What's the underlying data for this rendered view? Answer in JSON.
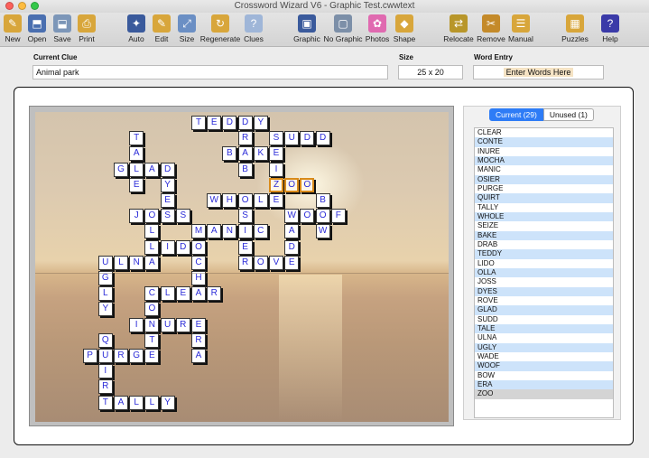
{
  "window": {
    "title": "Crossword Wizard V6 - Graphic Test.cwwtext"
  },
  "toolbar": {
    "items": [
      {
        "label": "New",
        "icon": "new-icon",
        "color": "#d8a63b"
      },
      {
        "label": "Open",
        "icon": "open-icon",
        "color": "#4a6fb0"
      },
      {
        "label": "Save",
        "icon": "save-icon",
        "color": "#7c96b8"
      },
      {
        "label": "Print",
        "icon": "print-icon",
        "color": "#d8a63b"
      },
      {
        "label": "Auto",
        "icon": "auto-icon",
        "color": "#3a5a9c"
      },
      {
        "label": "Edit",
        "icon": "edit-icon",
        "color": "#d8a63b"
      },
      {
        "label": "Size",
        "icon": "size-icon",
        "color": "#6b8fc4"
      },
      {
        "label": "Regenerate",
        "icon": "regenerate-icon",
        "color": "#d8a63b"
      },
      {
        "label": "Clues",
        "icon": "clues-icon",
        "color": "#9fb6d8"
      },
      {
        "label": "Graphic",
        "icon": "graphic-icon",
        "color": "#3a5a9c"
      },
      {
        "label": "No Graphic",
        "icon": "no-graphic-icon",
        "color": "#7c8fa8"
      },
      {
        "label": "Photos",
        "icon": "photos-icon",
        "color": "#e06ab0"
      },
      {
        "label": "Shape",
        "icon": "shape-icon",
        "color": "#d8a63b"
      },
      {
        "label": "Relocate",
        "icon": "relocate-icon",
        "color": "#b8962a"
      },
      {
        "label": "Remove",
        "icon": "remove-icon",
        "color": "#c48a2a"
      },
      {
        "label": "Manual",
        "icon": "manual-icon",
        "color": "#d8a63b"
      },
      {
        "label": "Puzzles",
        "icon": "puzzles-icon",
        "color": "#d8a63b"
      },
      {
        "label": "Help",
        "icon": "help-icon",
        "color": "#3a3aa8"
      }
    ]
  },
  "fields": {
    "current_clue_label": "Current Clue",
    "current_clue_value": "Animal park",
    "size_label": "Size",
    "size_value": "25 x 20",
    "word_entry_label": "Word Entry",
    "word_entry_placeholder": "Enter Words Here"
  },
  "tabs": {
    "current": "Current (29)",
    "unused": "Unused (1)"
  },
  "words": [
    "CLEAR",
    "CONTE",
    "INURE",
    "MOCHA",
    "MANIC",
    "OSIER",
    "PURGE",
    "QUIRT",
    "TALLY",
    "WHOLE",
    "SEIZE",
    "BAKE",
    "DRAB",
    "TEDDY",
    "LIDO",
    "OLLA",
    "JOSS",
    "DYES",
    "ROVE",
    "GLAD",
    "SUDD",
    "TALE",
    "ULNA",
    "UGLY",
    "WADE",
    "WOOF",
    "BOW",
    "ERA",
    "ZOO"
  ],
  "selected_word": "ZOO",
  "grid_cells": [
    {
      "c": "T",
      "x": 0.0,
      "y": 0,
      "hl": false
    },
    {
      "c": "E",
      "x": 1.0,
      "y": 0,
      "hl": false
    },
    {
      "c": "D",
      "x": 2.0,
      "y": 0,
      "hl": false
    },
    {
      "c": "D",
      "x": 3.0,
      "y": 0,
      "hl": false
    },
    {
      "c": "Y",
      "x": 4.0,
      "y": 0,
      "hl": false
    },
    {
      "c": "R",
      "x": 3.0,
      "y": 1,
      "hl": false
    },
    {
      "c": "S",
      "x": 5.0,
      "y": 1,
      "hl": false
    },
    {
      "c": "U",
      "x": 6.0,
      "y": 1,
      "hl": false
    },
    {
      "c": "D",
      "x": 7.0,
      "y": 1,
      "hl": false
    },
    {
      "c": "D",
      "x": 8.0,
      "y": 1,
      "hl": false
    },
    {
      "c": "T",
      "x": -4.0,
      "y": 1,
      "hl": false
    },
    {
      "c": "A",
      "x": -4.0,
      "y": 2,
      "hl": false
    },
    {
      "c": "L",
      "x": -4.0,
      "y": 3,
      "hl": false
    },
    {
      "c": "E",
      "x": -4.0,
      "y": 4,
      "hl": false
    },
    {
      "c": "B",
      "x": 2.0,
      "y": 2,
      "hl": false
    },
    {
      "c": "A",
      "x": 3.0,
      "y": 2,
      "hl": false
    },
    {
      "c": "K",
      "x": 4.0,
      "y": 2,
      "hl": false
    },
    {
      "c": "E",
      "x": 5.0,
      "y": 2,
      "hl": false
    },
    {
      "c": "G",
      "x": -5.0,
      "y": 3,
      "hl": false
    },
    {
      "c": "A",
      "x": -3.0,
      "y": 3,
      "hl": false
    },
    {
      "c": "D",
      "x": -2.0,
      "y": 3,
      "hl": false
    },
    {
      "c": "B",
      "x": 3.0,
      "y": 3,
      "hl": false
    },
    {
      "c": "I",
      "x": 5.0,
      "y": 3,
      "hl": false
    },
    {
      "c": "Z",
      "x": 5.0,
      "y": 4,
      "hl": true
    },
    {
      "c": "O",
      "x": 6.0,
      "y": 4,
      "hl": true
    },
    {
      "c": "O",
      "x": 7.0,
      "y": 4,
      "hl": true
    },
    {
      "c": "Y",
      "x": -2.0,
      "y": 4,
      "hl": false
    },
    {
      "c": "E",
      "x": -2.0,
      "y": 5,
      "hl": false
    },
    {
      "c": "W",
      "x": 1.0,
      "y": 5,
      "hl": false
    },
    {
      "c": "H",
      "x": 2.0,
      "y": 5,
      "hl": false
    },
    {
      "c": "O",
      "x": 3.0,
      "y": 5,
      "hl": false
    },
    {
      "c": "L",
      "x": 4.0,
      "y": 5,
      "hl": false
    },
    {
      "c": "E",
      "x": 5.0,
      "y": 5,
      "hl": false
    },
    {
      "c": "B",
      "x": 8.0,
      "y": 5,
      "hl": false
    },
    {
      "c": "J",
      "x": -4.0,
      "y": 6,
      "hl": false
    },
    {
      "c": "O",
      "x": -3.0,
      "y": 6,
      "hl": false
    },
    {
      "c": "S",
      "x": -2.0,
      "y": 6,
      "hl": false
    },
    {
      "c": "S",
      "x": -1.0,
      "y": 6,
      "hl": false
    },
    {
      "c": "S",
      "x": 3.0,
      "y": 6,
      "hl": false
    },
    {
      "c": "W",
      "x": 6.0,
      "y": 6,
      "hl": false
    },
    {
      "c": "O",
      "x": 7.0,
      "y": 6,
      "hl": false
    },
    {
      "c": "O",
      "x": 8.0,
      "y": 6,
      "hl": false
    },
    {
      "c": "F",
      "x": 9.0,
      "y": 6,
      "hl": false
    },
    {
      "c": "L",
      "x": -3.0,
      "y": 7,
      "hl": false
    },
    {
      "c": "M",
      "x": 0.0,
      "y": 7,
      "hl": false
    },
    {
      "c": "A",
      "x": 1.0,
      "y": 7,
      "hl": false
    },
    {
      "c": "N",
      "x": 2.0,
      "y": 7,
      "hl": false
    },
    {
      "c": "I",
      "x": 3.0,
      "y": 7,
      "hl": false
    },
    {
      "c": "C",
      "x": 4.0,
      "y": 7,
      "hl": false
    },
    {
      "c": "A",
      "x": 6.0,
      "y": 7,
      "hl": false
    },
    {
      "c": "W",
      "x": 8.0,
      "y": 7,
      "hl": false
    },
    {
      "c": "L",
      "x": -3.0,
      "y": 8,
      "hl": false
    },
    {
      "c": "I",
      "x": -2.0,
      "y": 8,
      "hl": false
    },
    {
      "c": "D",
      "x": -1.0,
      "y": 8,
      "hl": false
    },
    {
      "c": "O",
      "x": 0.0,
      "y": 8,
      "hl": false
    },
    {
      "c": "E",
      "x": 3.0,
      "y": 8,
      "hl": false
    },
    {
      "c": "D",
      "x": 6.0,
      "y": 8,
      "hl": false
    },
    {
      "c": "U",
      "x": -6.0,
      "y": 9,
      "hl": false
    },
    {
      "c": "L",
      "x": -5.0,
      "y": 9,
      "hl": false
    },
    {
      "c": "N",
      "x": -4.0,
      "y": 9,
      "hl": false
    },
    {
      "c": "A",
      "x": -3.0,
      "y": 9,
      "hl": false
    },
    {
      "c": "C",
      "x": 0.0,
      "y": 9,
      "hl": false
    },
    {
      "c": "R",
      "x": 3.0,
      "y": 9,
      "hl": false
    },
    {
      "c": "O",
      "x": 4.0,
      "y": 9,
      "hl": false
    },
    {
      "c": "V",
      "x": 5.0,
      "y": 9,
      "hl": false
    },
    {
      "c": "E",
      "x": 6.0,
      "y": 9,
      "hl": false
    },
    {
      "c": "G",
      "x": -6.0,
      "y": 10,
      "hl": false
    },
    {
      "c": "H",
      "x": 0.0,
      "y": 10,
      "hl": false
    },
    {
      "c": "L",
      "x": -6.0,
      "y": 11,
      "hl": false
    },
    {
      "c": "C",
      "x": -3.0,
      "y": 11,
      "hl": false
    },
    {
      "c": "L",
      "x": -2.0,
      "y": 11,
      "hl": false
    },
    {
      "c": "E",
      "x": -1.0,
      "y": 11,
      "hl": false
    },
    {
      "c": "A",
      "x": 0.0,
      "y": 11,
      "hl": false
    },
    {
      "c": "R",
      "x": 1.0,
      "y": 11,
      "hl": false
    },
    {
      "c": "Y",
      "x": -6.0,
      "y": 12,
      "hl": false
    },
    {
      "c": "O",
      "x": -3.0,
      "y": 12,
      "hl": false
    },
    {
      "c": "I",
      "x": -4.0,
      "y": 13,
      "hl": false
    },
    {
      "c": "N",
      "x": -3.0,
      "y": 13,
      "hl": false
    },
    {
      "c": "U",
      "x": -2.0,
      "y": 13,
      "hl": false
    },
    {
      "c": "R",
      "x": -1.0,
      "y": 13,
      "hl": false
    },
    {
      "c": "E",
      "x": 0.0,
      "y": 13,
      "hl": false
    },
    {
      "c": "Q",
      "x": -6.0,
      "y": 14,
      "hl": false
    },
    {
      "c": "T",
      "x": -3.0,
      "y": 14,
      "hl": false
    },
    {
      "c": "R",
      "x": 0.0,
      "y": 14,
      "hl": false
    },
    {
      "c": "P",
      "x": -7.0,
      "y": 15,
      "hl": false
    },
    {
      "c": "U",
      "x": -6.0,
      "y": 15,
      "hl": false
    },
    {
      "c": "R",
      "x": -5.0,
      "y": 15,
      "hl": false
    },
    {
      "c": "G",
      "x": -4.0,
      "y": 15,
      "hl": false
    },
    {
      "c": "E",
      "x": -3.0,
      "y": 15,
      "hl": false
    },
    {
      "c": "A",
      "x": 0.0,
      "y": 15,
      "hl": false
    },
    {
      "c": "I",
      "x": -6.0,
      "y": 16,
      "hl": false
    },
    {
      "c": "R",
      "x": -6.0,
      "y": 17,
      "hl": false
    },
    {
      "c": "T",
      "x": -6.0,
      "y": 18,
      "hl": false
    },
    {
      "c": "A",
      "x": -5.0,
      "y": 18,
      "hl": false
    },
    {
      "c": "L",
      "x": -4.0,
      "y": 18,
      "hl": false
    },
    {
      "c": "L",
      "x": -3.0,
      "y": 18,
      "hl": false
    },
    {
      "c": "Y",
      "x": -2.0,
      "y": 18,
      "hl": false
    }
  ]
}
